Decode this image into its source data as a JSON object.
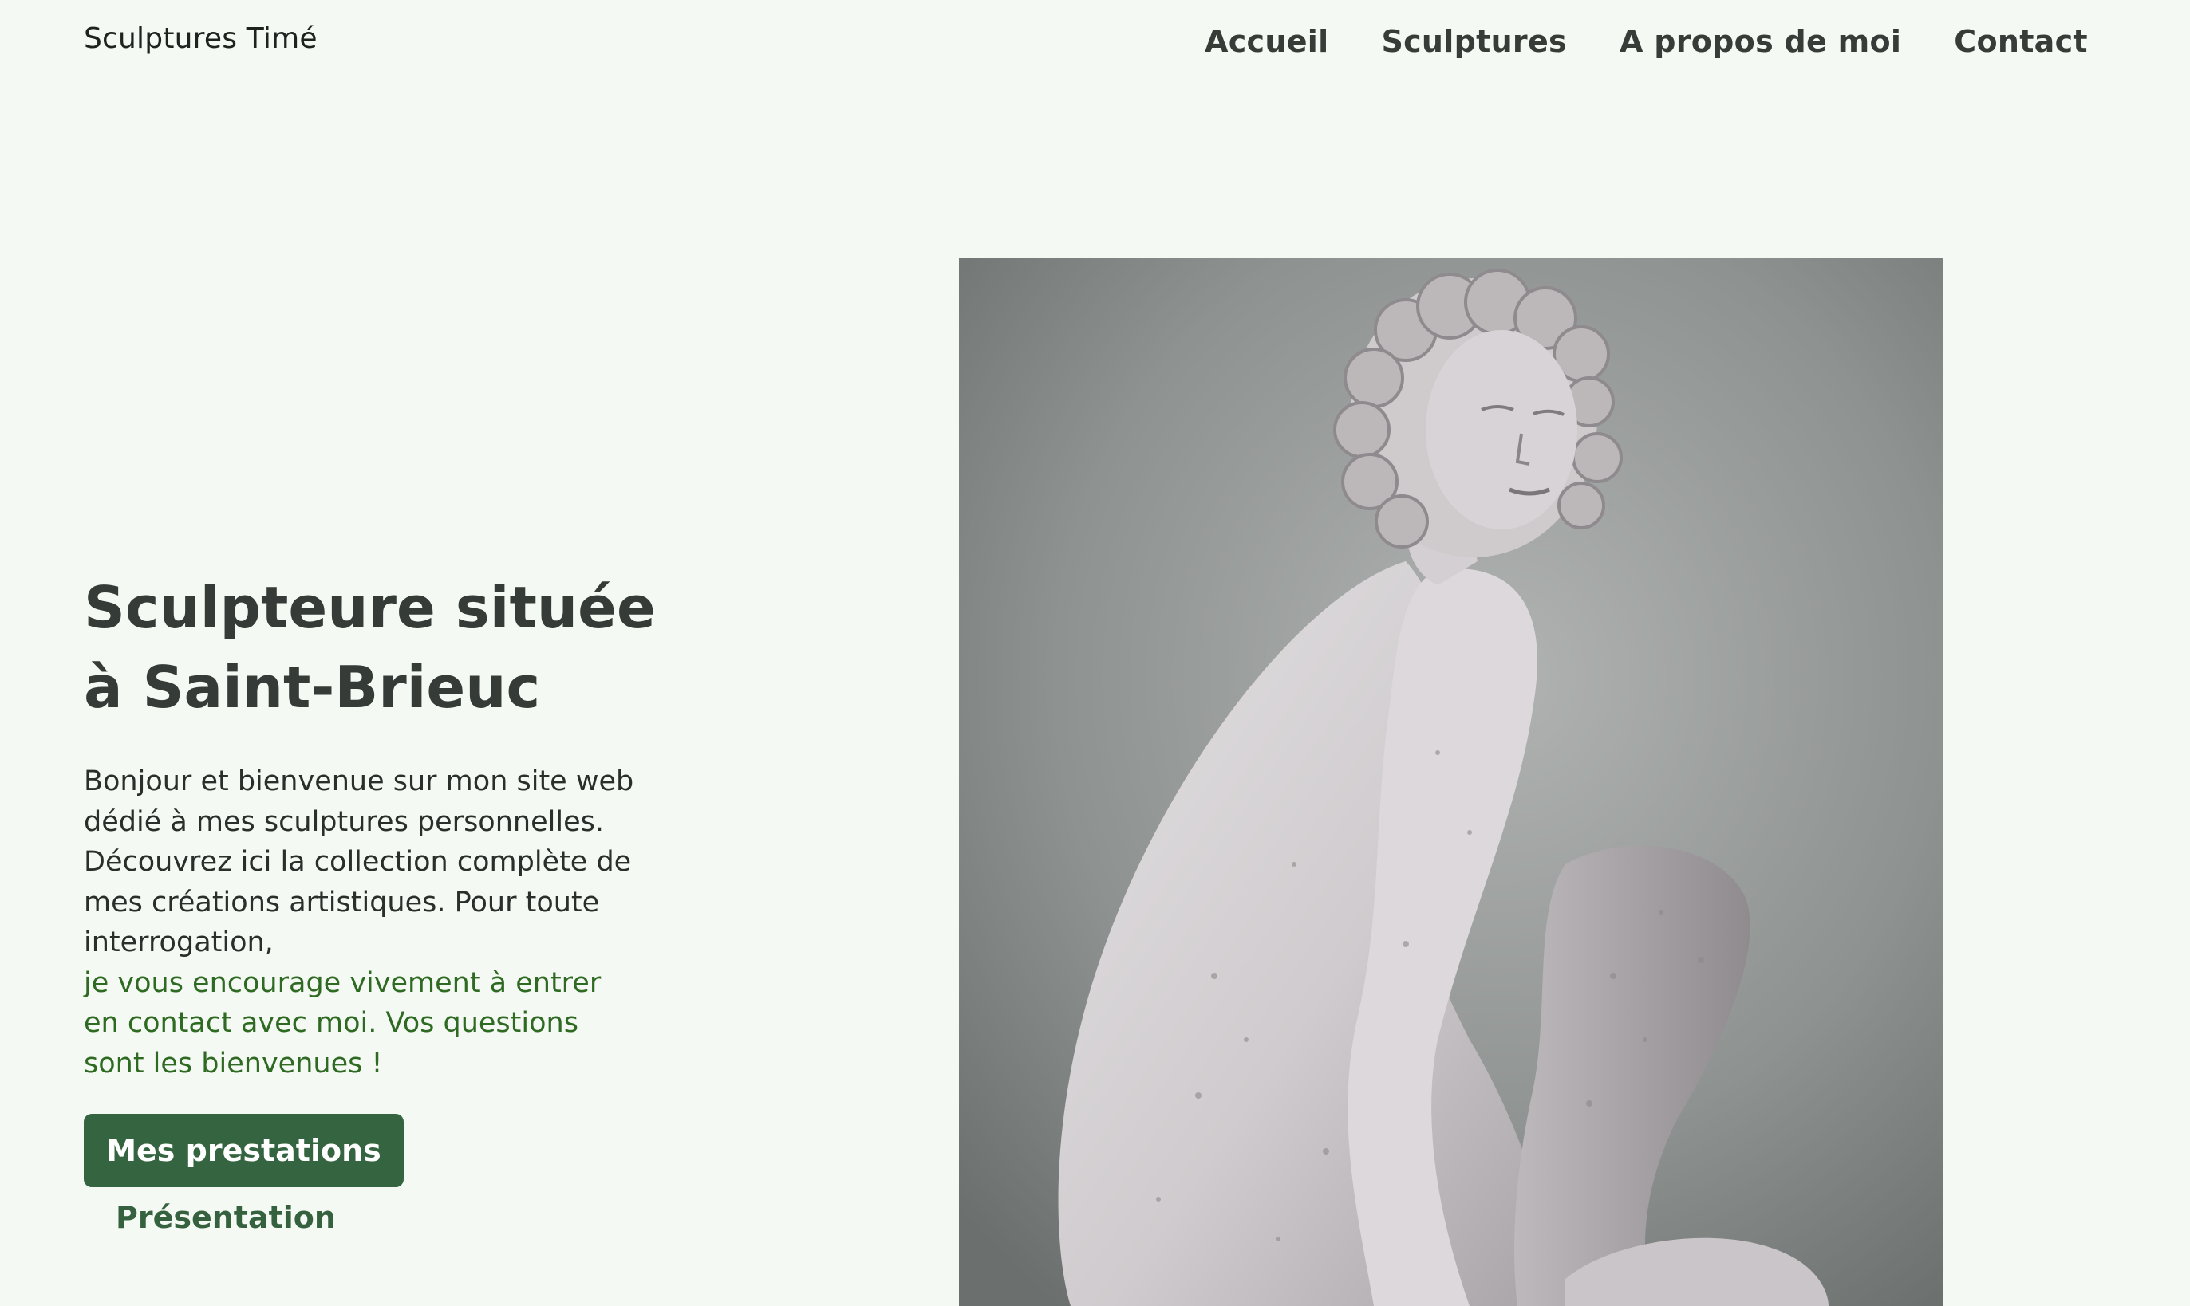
{
  "header": {
    "brand": "Sculptures Timé",
    "nav": [
      {
        "label": "Accueil"
      },
      {
        "label": "Sculptures"
      },
      {
        "label": "A propos de moi"
      },
      {
        "label": "Contact"
      }
    ]
  },
  "hero": {
    "title_line1": "Sculpteure située",
    "title_line2": "à Saint-Brieuc",
    "text_main": "Bonjour et bienvenue sur mon site web dédié à mes sculptures personnelles. Découvrez ici la collection complète de mes créations artistiques. Pour toute interrogation,",
    "text_accent": "je vous encourage vivement à entrer en contact avec moi. Vos questions sont les bienvenues !",
    "primary_button": "Mes prestations",
    "secondary_button": "Présentation"
  },
  "colors": {
    "background": "#f4f9f3",
    "accent_text": "#2e6a22",
    "button_bg": "#356440",
    "heading": "#353b37"
  }
}
